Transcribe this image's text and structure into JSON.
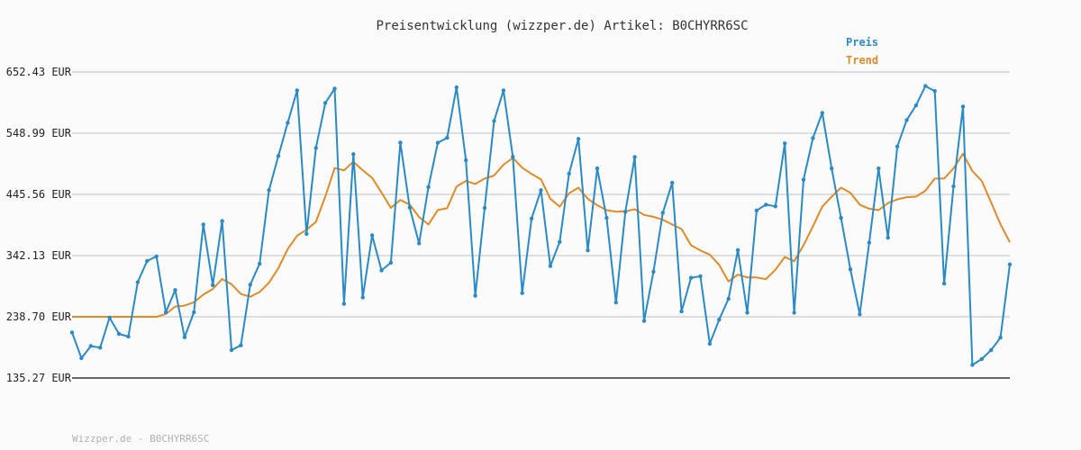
{
  "chart_data": {
    "type": "line",
    "title": "Preisentwicklung (wizzper.de) Artikel: B0CHYRR6SC",
    "footer": "Wizzper.de - B0CHYRR6SC",
    "ylim": [
      135.27,
      652.43
    ],
    "yticks": [
      "135.27 EUR",
      "238.70 EUR",
      "342.13 EUR",
      "445.56 EUR",
      "548.99 EUR",
      "652.43 EUR"
    ],
    "grid": true,
    "legend_position": "top-right",
    "series": [
      {
        "name": "Preis",
        "color": "#2a8ac8",
        "values": [
          212.19,
          168.73,
          189.23,
          186.53,
          237.33,
          209.85,
          205.29,
          297.19,
          333.19,
          340.74,
          246.39,
          283.86,
          204.19,
          246.39,
          394.67,
          292.2,
          400.54,
          182.49,
          190.49,
          293.07,
          328.48,
          452.75,
          510.47,
          566.67,
          621.46,
          378.87,
          524.1,
          599.88,
          624.49,
          260.63,
          513.51,
          271.42,
          376.38,
          317.26,
          330.07,
          532.99,
          423.28,
          362.62,
          458.0,
          532.93,
          541.24,
          626.44,
          503.37,
          274.33,
          422.62,
          569.68,
          621.46,
          509.22,
          278.76,
          404.82,
          452.75,
          324.53,
          365.27,
          480.65,
          539.38,
          350.97,
          489.4,
          405.91,
          262.98,
          416.03,
          508.85,
          231.7,
          314.98,
          414.53,
          465.21,
          247.78,
          304.53,
          307.16,
          193.01,
          233.79,
          269.09,
          351.46,
          245.72,
          418.5,
          428.2,
          425.27,
          531.76,
          245.72,
          470.56,
          540.58,
          583.41,
          489.4,
          405.91,
          318.92,
          242.75,
          364.06,
          489.4,
          372.43,
          526.43,
          571.28,
          596.02,
          628.69,
          620.13,
          294.83,
          459.23,
          593.97,
          157.27,
          167.39,
          182.49,
          203.51,
          327.22
        ]
      },
      {
        "name": "Trend",
        "color": "#e08a28",
        "values": [
          238.7,
          238.7,
          238.7,
          238.7,
          238.7,
          238.7,
          238.7,
          238.7,
          238.7,
          238.7,
          243.41,
          256.03,
          257.54,
          263.39,
          276.18,
          285.76,
          302.66,
          293.69,
          277.19,
          272.61,
          280.6,
          296.28,
          320.86,
          353.26,
          375.68,
          385.74,
          399.14,
          441.77,
          490.13,
          486.17,
          500.78,
          486.4,
          473.58,
          448.7,
          422.78,
          436.11,
          428.17,
          407.23,
          394.69,
          419.14,
          422.16,
          458.87,
          468.33,
          463.17,
          472.38,
          477.5,
          495.78,
          507.13,
          490.74,
          480.12,
          471.08,
          438.19,
          424.86,
          447.37,
          456.93,
          438.11,
          427.37,
          418.9,
          416.43,
          416.99,
          420.51,
          410.83,
          407.72,
          402.69,
          394.69,
          387.04,
          359.59,
          350.86,
          343.68,
          326.69,
          298.46,
          309.98,
          305.13,
          305.13,
          302.37,
          318.19,
          339.85,
          332.53,
          359.74,
          391.57,
          424.86,
          441.77,
          456.93,
          448.24,
          428.17,
          421.4,
          418.9,
          430.77,
          437.27,
          440.78,
          441.77,
          451.85,
          472.38,
          472.38,
          489.71,
          514.2,
          485.14,
          468.33,
          432.03,
          395.21,
          364.57
        ]
      }
    ]
  }
}
